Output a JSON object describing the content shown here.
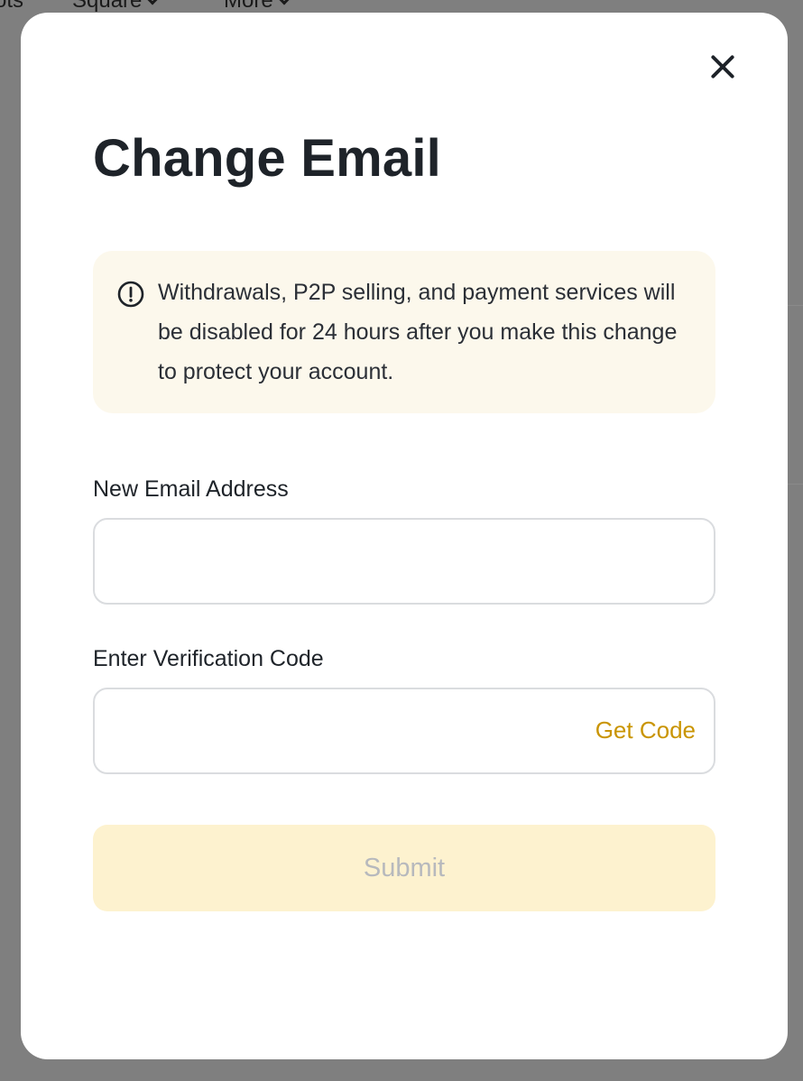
{
  "background": {
    "nav_items": [
      {
        "label": "ots"
      },
      {
        "label": "Square"
      },
      {
        "label": "More"
      }
    ]
  },
  "modal": {
    "title": "Change Email",
    "close_icon": "close-icon",
    "notice": {
      "icon": "alert-circle-icon",
      "text": "Withdrawals, P2P selling, and payment services will be disabled for 24 hours after you make this change to protect your account."
    },
    "email_field": {
      "label": "New Email Address",
      "value": "",
      "placeholder": ""
    },
    "code_field": {
      "label": "Enter Verification Code",
      "value": "",
      "placeholder": "",
      "get_code_label": "Get Code"
    },
    "submit_label": "Submit"
  },
  "colors": {
    "accent": "#c99400",
    "notice_bg": "#fcf8ec",
    "submit_disabled_bg": "#fdf2cf",
    "submit_disabled_text": "#b7b9bd"
  }
}
